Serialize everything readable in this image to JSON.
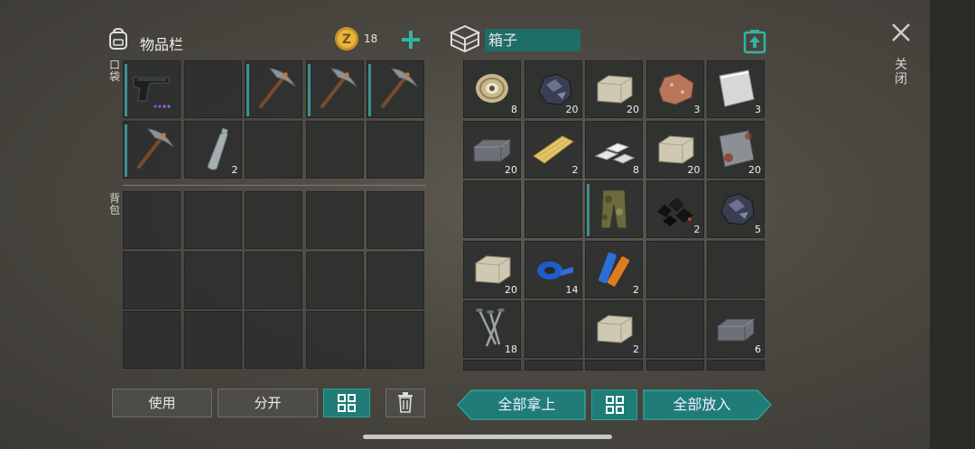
{
  "inventory": {
    "title": "物品栏",
    "coins": "18",
    "pocket_label": "口袋",
    "backpack_label": "背包",
    "pocket_slots": [
      {
        "item": "pistol",
        "count": ""
      },
      {
        "item": "",
        "count": ""
      },
      {
        "item": "pickaxe",
        "count": ""
      },
      {
        "item": "pickaxe",
        "count": ""
      },
      {
        "item": "pickaxe",
        "count": ""
      },
      {
        "item": "pickaxe",
        "count": ""
      },
      {
        "item": "bottle",
        "count": "2"
      },
      {
        "item": "",
        "count": ""
      },
      {
        "item": "",
        "count": ""
      },
      {
        "item": "",
        "count": ""
      }
    ]
  },
  "container": {
    "title": "箱子",
    "slots": [
      {
        "item": "wire-spool",
        "count": "8"
      },
      {
        "item": "coal-ore",
        "count": "20"
      },
      {
        "item": "stone-block",
        "count": "20"
      },
      {
        "item": "copper-ore",
        "count": "3"
      },
      {
        "item": "metal-sheet",
        "count": "3"
      },
      {
        "item": "iron-ingot",
        "count": "20"
      },
      {
        "item": "wood-plank",
        "count": "2"
      },
      {
        "item": "aluminum-bars",
        "count": "8"
      },
      {
        "item": "stone-block",
        "count": "20"
      },
      {
        "item": "rusty-plate",
        "count": "20"
      },
      {
        "item": "",
        "count": ""
      },
      {
        "item": "",
        "count": ""
      },
      {
        "item": "camo-pants",
        "count": ""
      },
      {
        "item": "coal",
        "count": "2"
      },
      {
        "item": "coal-ore",
        "count": "5"
      },
      {
        "item": "stone-block",
        "count": "20"
      },
      {
        "item": "blue-tape",
        "count": "14"
      },
      {
        "item": "batteries",
        "count": "2"
      },
      {
        "item": "",
        "count": ""
      },
      {
        "item": "",
        "count": ""
      },
      {
        "item": "nails",
        "count": "18"
      },
      {
        "item": "",
        "count": ""
      },
      {
        "item": "stone-block",
        "count": "2"
      },
      {
        "item": "",
        "count": ""
      },
      {
        "item": "iron-ingot",
        "count": "6"
      }
    ]
  },
  "buttons": {
    "use": "使用",
    "split": "分开",
    "take_all": "全部拿上",
    "put_all": "全部放入",
    "close": "关闭"
  },
  "colors": {
    "accent": "#1f7c76",
    "slot": "#2e302f",
    "bar": "#3f8f8e"
  }
}
